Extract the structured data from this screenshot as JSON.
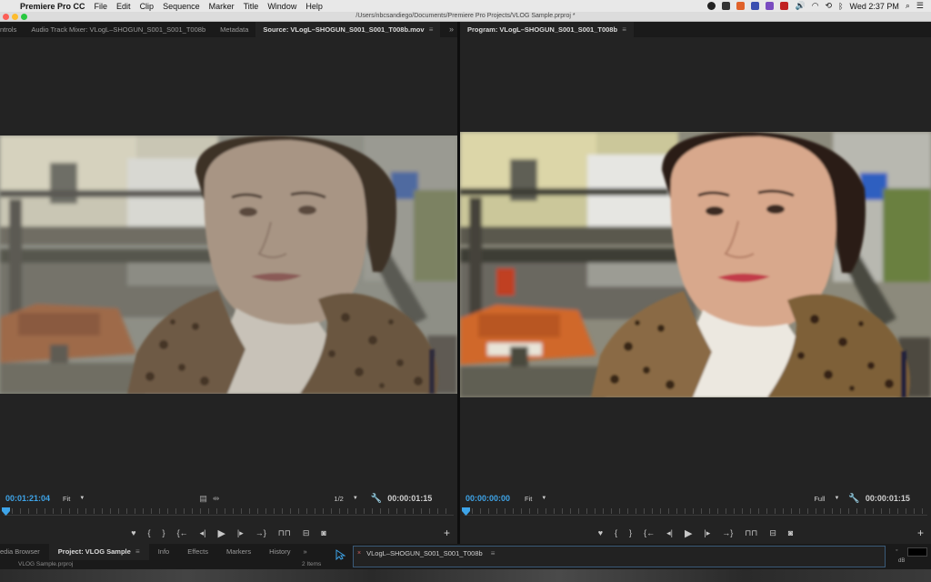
{
  "menubar": {
    "app_name": "Premiere Pro CC",
    "items": [
      "File",
      "Edit",
      "Clip",
      "Sequence",
      "Marker",
      "Title",
      "Window",
      "Help"
    ],
    "clock": "Wed 2:37 PM"
  },
  "window": {
    "path": "/Users/nbcsandiego/Documents/Premiere Pro Projects/VLOG Sample.prproj *"
  },
  "source_panel": {
    "tabs": [
      "ntrols",
      "Audio Track Mixer: VLogL–SHOGUN_S001_S001_T008b",
      "Metadata",
      "Source: VLogL–SHOGUN_S001_S001_T008b.mov"
    ],
    "active_tab_index": 3,
    "timecode": "00:01:21:04",
    "zoom": "Fit",
    "resolution": "1/2",
    "duration": "00:00:01:15"
  },
  "program_panel": {
    "tab": "Program: VLogL–SHOGUN_S001_S001_T008b",
    "timecode": "00:00:00:00",
    "zoom": "Fit",
    "resolution": "Full",
    "duration": "00:00:01:15"
  },
  "dock": {
    "tabs": [
      "edia Browser",
      "Project: VLOG Sample",
      "Info",
      "Effects",
      "Markers",
      "History"
    ],
    "active_tab_index": 1,
    "project_file": "VLOG Sample.prproj",
    "item_count": "2 Items",
    "sequence_tab": "VLogL–SHOGUN_S001_S001_T008b",
    "meter_label": "dB"
  },
  "colors": {
    "accent_blue": "#3ea4e8",
    "panel_bg": "#232323",
    "tab_bg": "#1a1a1a"
  }
}
